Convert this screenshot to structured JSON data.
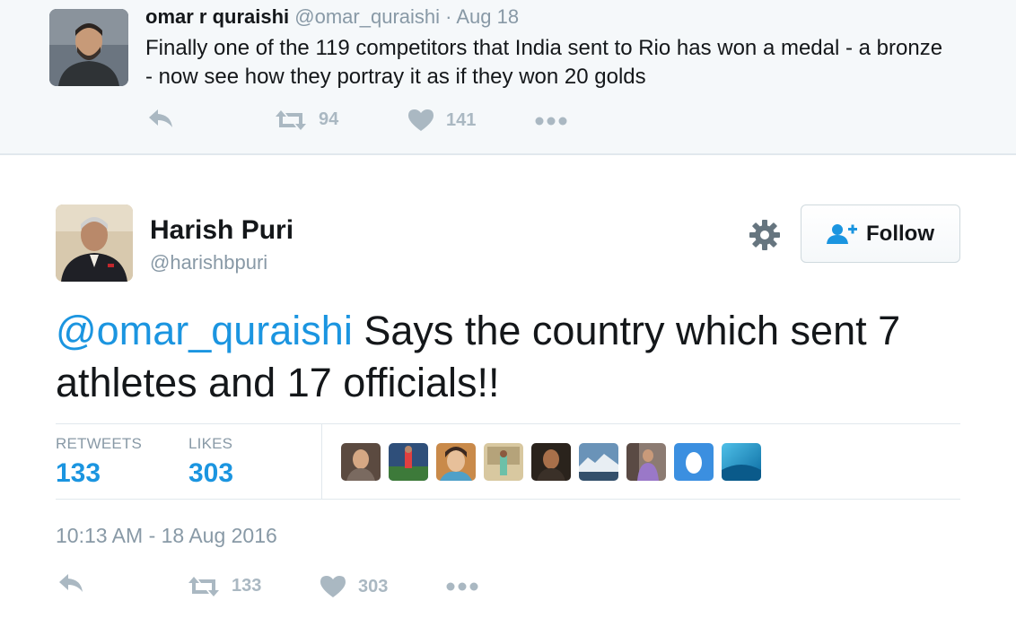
{
  "parent_tweet": {
    "name": "omar r quraishi",
    "handle": "@omar_quraishi",
    "separator": "·",
    "date": "Aug 18",
    "text": "Finally one of the 119 competitors that India sent to Rio has won a medal - a bronze - now see how they portray it as if they won 20 golds",
    "actions": {
      "retweet_count": "94",
      "like_count": "141"
    }
  },
  "main_tweet": {
    "name": "Harish Puri",
    "handle": "@harishbpuri",
    "follow_label": "Follow",
    "mention": "@omar_quraishi",
    "text": " Says the country which sent 7 athletes and 17 officials!!",
    "stats": {
      "retweets_label": "RETWEETS",
      "retweets_value": "133",
      "likes_label": "LIKES",
      "likes_value": "303"
    },
    "timestamp": "10:13 AM - 18 Aug 2016",
    "actions": {
      "retweet_count": "133",
      "like_count": "303"
    }
  },
  "colors": {
    "link_blue": "#1b95e0",
    "muted_gray": "#8899a6",
    "icon_gray": "#aab8c2",
    "parent_bg": "#f5f8fa"
  },
  "icons": [
    "reply-icon",
    "retweet-icon",
    "heart-icon",
    "more-icon",
    "gear-icon",
    "follow-person-icon"
  ]
}
